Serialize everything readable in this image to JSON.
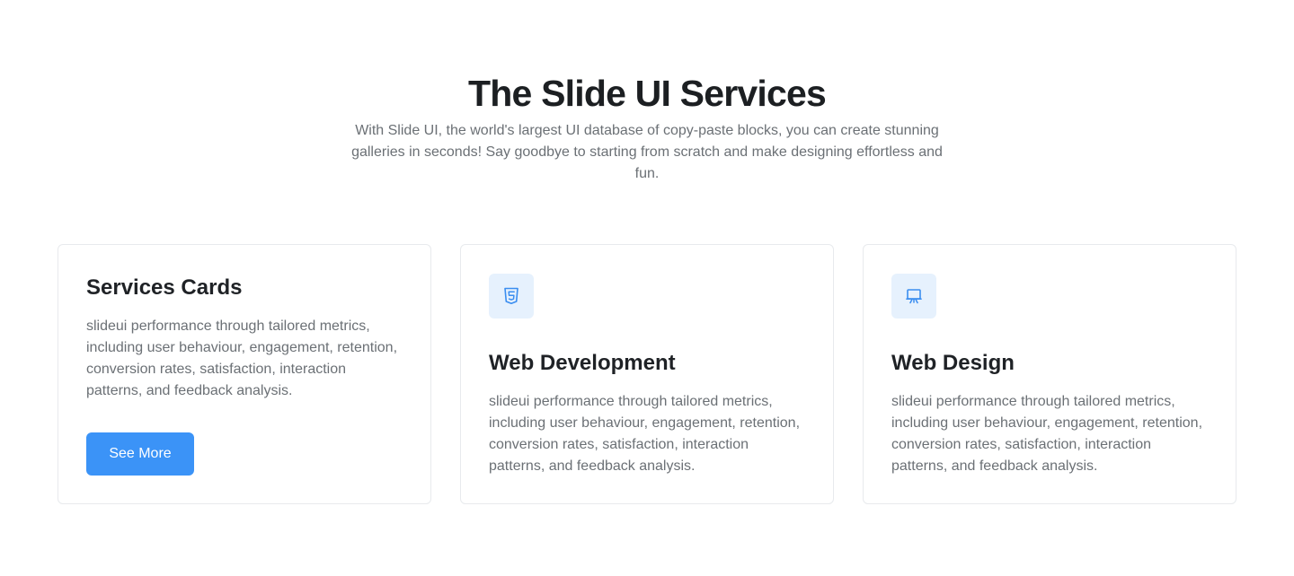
{
  "header": {
    "title": "The Slide UI Services",
    "subtitle": "With Slide UI, the world's largest UI database of copy-paste blocks, you can create stunning galleries in seconds! Say goodbye to starting from scratch and make designing effortless and fun."
  },
  "cards": [
    {
      "title": "Services Cards",
      "text": "slideui performance through tailored metrics, including user behaviour, engagement, retention, conversion rates, satisfaction, interaction patterns, and feedback analysis.",
      "button_label": "See More"
    },
    {
      "icon": "html5-icon",
      "title": "Web Development",
      "text": "slideui performance through tailored metrics, including user behaviour, engagement, retention, conversion rates, satisfaction, interaction patterns, and feedback analysis."
    },
    {
      "icon": "presentation-screen-icon",
      "title": "Web Design",
      "text": "slideui performance through tailored metrics, including user behaviour, engagement, retention, conversion rates, satisfaction, interaction patterns, and feedback analysis."
    }
  ],
  "colors": {
    "accent": "#3b93f7",
    "icon_bg": "#e6f1fd",
    "title": "#1c1f22",
    "body_text": "#6b7075",
    "card_border": "#e8eaed"
  }
}
